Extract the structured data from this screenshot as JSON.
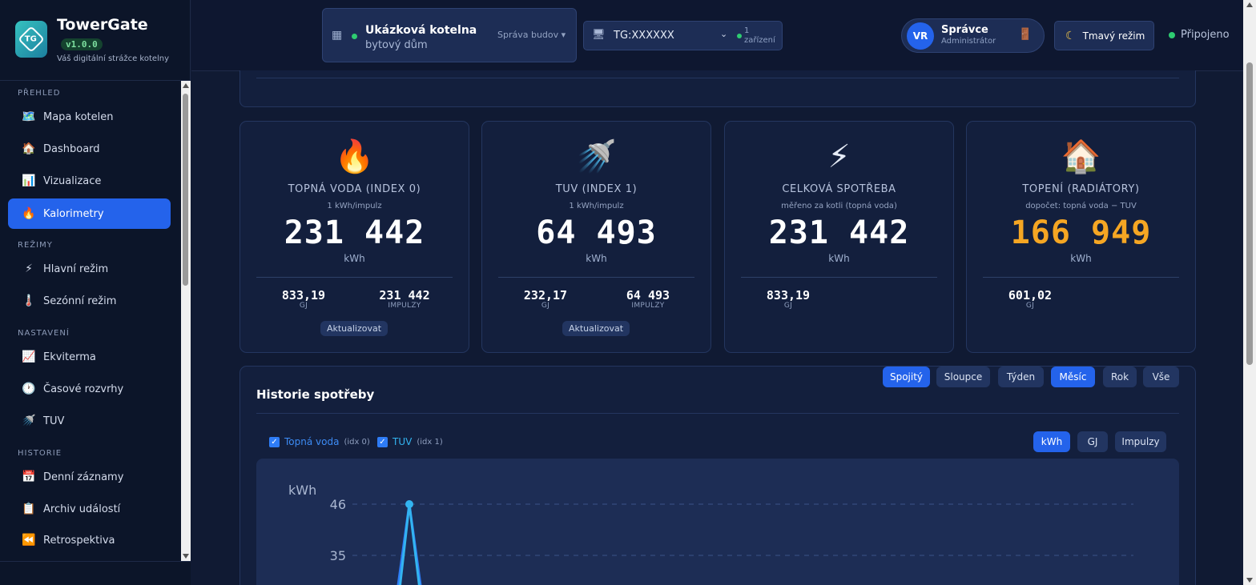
{
  "app": {
    "name": "TowerGate",
    "version": "v1.0.0",
    "tagline": "Váš digitální strážce kotelny",
    "logo_text": "TG"
  },
  "sidebar": {
    "sections": [
      {
        "label": "PŘEHLED",
        "items": [
          {
            "label": "Mapa kotelen",
            "icon": "🗺️"
          },
          {
            "label": "Dashboard",
            "icon": "🏠"
          },
          {
            "label": "Vizualizace",
            "icon": "📊"
          },
          {
            "label": "Kalorimetry",
            "icon": "🔥",
            "active": true
          }
        ]
      },
      {
        "label": "REŽIMY",
        "items": [
          {
            "label": "Hlavní režim",
            "icon": "⚡"
          },
          {
            "label": "Sezónní režim",
            "icon": "🌡️"
          }
        ]
      },
      {
        "label": "NASTAVENÍ",
        "items": [
          {
            "label": "Ekviterma",
            "icon": "📈"
          },
          {
            "label": "Časové rozvrhy",
            "icon": "🕐"
          },
          {
            "label": "TUV",
            "icon": "🚿"
          }
        ]
      },
      {
        "label": "HISTORIE",
        "items": [
          {
            "label": "Denní záznamy",
            "icon": "📅"
          },
          {
            "label": "Archiv událostí",
            "icon": "📋"
          },
          {
            "label": "Retrospektiva",
            "icon": "⏪"
          }
        ]
      }
    ]
  },
  "header": {
    "building": {
      "name": "Ukázková kotelna",
      "type": "bytový dům",
      "manage_label": "Správa budov ▾"
    },
    "device": {
      "id": "TG:XXXXXX",
      "count_line1": "1",
      "count_line2": "zařízení"
    },
    "user": {
      "initials": "VR",
      "name": "Správce",
      "role": "Administrátor"
    },
    "theme_label": "Tmavý režim",
    "connection_label": "Připojeno"
  },
  "cards": [
    {
      "icon": "🔥",
      "title": "TOPNÁ VODA (INDEX 0)",
      "subtitle": "1 kWh/impulz",
      "value": "231 442",
      "unit": "kWh",
      "stats": [
        {
          "value": "833,19",
          "label": "GJ"
        },
        {
          "value": "231 442",
          "label": "IMPULZY"
        }
      ],
      "button": "Aktualizovat"
    },
    {
      "icon": "🚿",
      "title": "TUV (INDEX 1)",
      "subtitle": "1 kWh/impulz",
      "value": "64 493",
      "unit": "kWh",
      "stats": [
        {
          "value": "232,17",
          "label": "GJ"
        },
        {
          "value": "64 493",
          "label": "IMPULZY"
        }
      ],
      "button": "Aktualizovat"
    },
    {
      "icon": "⚡",
      "title": "CELKOVÁ SPOTŘEBA",
      "subtitle": "měřeno za kotli (topná voda)",
      "value": "231 442",
      "unit": "kWh",
      "stats": [
        {
          "value": "833,19",
          "label": "GJ"
        }
      ]
    },
    {
      "icon": "🏠",
      "title": "TOPENÍ (RADIÁTORY)",
      "subtitle": "dopočet: topná voda − TUV",
      "value": "166 949",
      "unit": "kWh",
      "value_color": "#f5a623",
      "stats": [
        {
          "value": "601,02",
          "label": "GJ"
        }
      ]
    }
  ],
  "history": {
    "title": "Historie spotřeby",
    "view_buttons": [
      {
        "label": "Spojitý",
        "active": true
      },
      {
        "label": "Sloupce"
      },
      {
        "label": "Týden"
      },
      {
        "label": "Měsíc",
        "active": true
      },
      {
        "label": "Rok"
      },
      {
        "label": "Vše"
      }
    ],
    "unit_buttons": [
      {
        "label": "kWh",
        "active": true
      },
      {
        "label": "GJ"
      },
      {
        "label": "Impulzy"
      }
    ],
    "legend": [
      {
        "name": "Topná voda",
        "idx": "(idx 0)",
        "checked": true
      },
      {
        "name": "TUV",
        "idx": "(idx 1)",
        "checked": true
      }
    ]
  },
  "chart_data": {
    "type": "line",
    "ylabel": "kWh",
    "y_ticks": [
      46,
      35
    ],
    "series": [
      {
        "name": "Topná voda",
        "color": "#2e7cf6",
        "values": [
          46
        ]
      },
      {
        "name": "TUV",
        "color": "#33b4f0",
        "values": [
          46
        ]
      }
    ]
  }
}
